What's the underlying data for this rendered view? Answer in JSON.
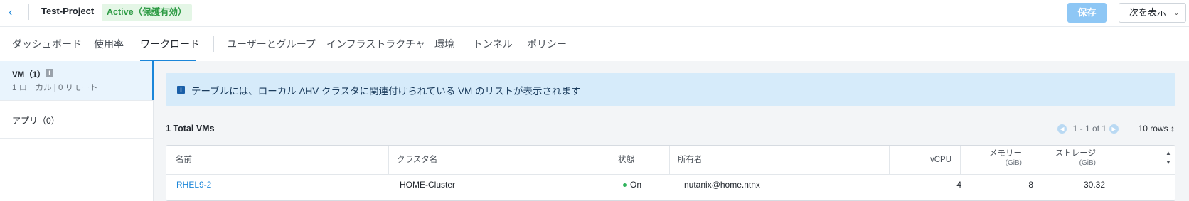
{
  "header": {
    "back_icon": "chevron-left-icon",
    "project_name": "Test-Project",
    "status_badge": "Active（保護有効）",
    "save_label": "保存",
    "view_label": "次を表示",
    "colors": {
      "accent": "#1b86d9",
      "status_green": "#2e9b45",
      "save_disabled": "#8ec7f5"
    }
  },
  "tabs": [
    {
      "label": "ダッシュボード",
      "active": false
    },
    {
      "label": "使用率",
      "active": false
    },
    {
      "label": "ワークロード",
      "active": true
    },
    {
      "label": "ユーザーとグループ",
      "active": false
    },
    {
      "label": "インフラストラクチャ",
      "active": false
    },
    {
      "label": "環境",
      "active": false
    },
    {
      "label": "トンネル",
      "active": false
    },
    {
      "label": "ポリシー",
      "active": false
    }
  ],
  "sidebar": {
    "vm": {
      "title": "VM（1）",
      "info_icon": "info-icon",
      "subtitle": "1 ローカル | 0 リモート",
      "selected": true
    },
    "app": {
      "label": "アプリ（0）"
    }
  },
  "main": {
    "banner": {
      "icon": "info-icon",
      "text": "テーブルには、ローカル AHV クラスタに関連付けられている VM のリストが表示されます"
    },
    "total": "1 Total VMs",
    "pagination": {
      "range": "1 - 1 of 1",
      "rows": "10 rows"
    },
    "table": {
      "headers": {
        "name": "名前",
        "cluster": "クラスタ名",
        "state": "状態",
        "owner": "所有者",
        "vcpu": "vCPU",
        "memory": "メモリー",
        "memory_unit": "(GiB)",
        "storage": "ストレージ",
        "storage_unit": "(GiB)"
      },
      "rows": [
        {
          "name": "RHEL9-2",
          "cluster": "HOME-Cluster",
          "state": "On",
          "owner": "nutanix@home.ntnx",
          "vcpu": "4",
          "memory": "8",
          "storage": "30.32"
        }
      ]
    }
  }
}
